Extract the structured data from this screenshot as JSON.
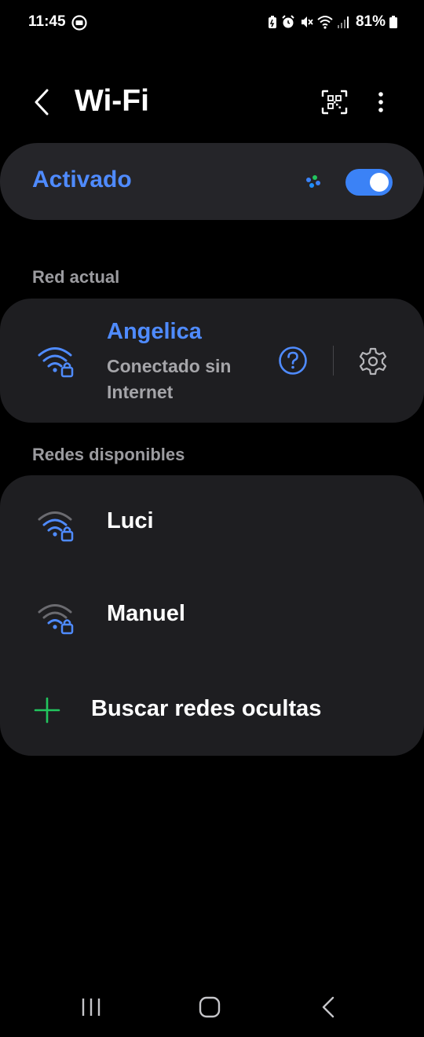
{
  "status_bar": {
    "time": "11:45",
    "battery": "81%",
    "icons": [
      "media-icon",
      "battery-saver-icon",
      "alarm-icon",
      "mute-icon",
      "wifi-icon",
      "signal-icon",
      "battery-icon"
    ]
  },
  "header": {
    "title": "Wi-Fi",
    "icons": [
      "back-icon",
      "qr-code-icon",
      "more-options-icon"
    ]
  },
  "master_switch": {
    "label": "Activado",
    "on": true,
    "accent_color": "#3b82f6"
  },
  "current_network": {
    "section_title": "Red actual",
    "name": "Angelica",
    "status": "Conectado sin Internet",
    "icons": [
      "wifi-lock-icon",
      "help-icon",
      "settings-icon"
    ]
  },
  "available": {
    "section_title": "Redes disponibles",
    "networks": [
      {
        "name": "Luci",
        "icon": "wifi-lock-icon"
      },
      {
        "name": "Manuel",
        "icon": "wifi-lock-icon"
      }
    ],
    "add_label": "Buscar redes ocultas",
    "add_icon": "plus-icon",
    "add_color": "#22c55e"
  },
  "nav": {
    "icons": [
      "recents-icon",
      "home-icon",
      "back-nav-icon"
    ]
  }
}
